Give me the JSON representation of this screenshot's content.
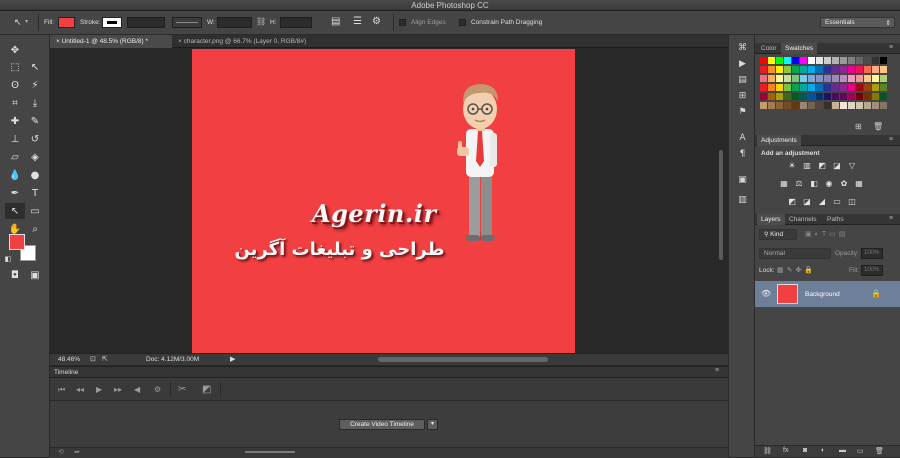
{
  "app": {
    "title": "Adobe Photoshop CC"
  },
  "options_bar": {
    "fill_label": "Fill:",
    "stroke_label": "Stroke:",
    "w_label": "W:",
    "h_label": "H:",
    "align_edges_label": "Align Edges",
    "constrain_label": "Constrain Path Dragging",
    "workspace": "Essentials",
    "fill_color": "#f23f41"
  },
  "tabs": [
    {
      "label": "Untitled-1 @ 48.5% (RGB/8) *",
      "close": "×"
    },
    {
      "label": "character.png @ 66.7% (Layer 0, RGB/8#)",
      "close": "×"
    }
  ],
  "canvas": {
    "bg": "#f23f41",
    "logo_text": "Agerin.ir",
    "persian_text": "طراحی و تبلیغات آگرین"
  },
  "status": {
    "zoom": "48.46%",
    "doc": "Doc: 4.12M/3.00M"
  },
  "timeline": {
    "title": "Timeline",
    "create_button": "Create Video Timeline"
  },
  "color_panel": {
    "tabs": [
      "Color",
      "Swatches"
    ],
    "swatch_rows": [
      [
        "#ff0000",
        "#ffff00",
        "#00ff00",
        "#00ffff",
        "#0000ff",
        "#ff00ff",
        "#ffffff",
        "#e6e6e6",
        "#cccccc",
        "#b3b3b3",
        "#999999",
        "#808080",
        "#666666",
        "#4d4d4d",
        "#333333",
        "#000000"
      ],
      [
        "#ed1c24",
        "#f7941d",
        "#fff200",
        "#8dc63f",
        "#00a651",
        "#00a99d",
        "#00aeef",
        "#0072bc",
        "#2e3192",
        "#662d91",
        "#92278f",
        "#ec008c",
        "#ed145b",
        "#f26c4f",
        "#f9ad81",
        "#fdc689"
      ],
      [
        "#f26d7d",
        "#fbaf5d",
        "#fff799",
        "#c4df9b",
        "#7cc576",
        "#6dcff6",
        "#7da7d9",
        "#8393ca",
        "#8781bd",
        "#a186be",
        "#bc8dbf",
        "#f49ac1",
        "#f5989d",
        "#fdc68a",
        "#fff79a",
        "#acd373"
      ],
      [
        "#ee1d23",
        "#f58220",
        "#ffd400",
        "#7cc242",
        "#00a54f",
        "#00a99e",
        "#00adee",
        "#0072bb",
        "#2e3191",
        "#652d90",
        "#91268f",
        "#eb008b",
        "#9e0b0f",
        "#a0410d",
        "#aba000",
        "#598527"
      ],
      [
        "#9e0039",
        "#a3620a",
        "#aba000",
        "#406618",
        "#005e20",
        "#005952",
        "#0054a6",
        "#003471",
        "#1b1464",
        "#440e62",
        "#630460",
        "#9e005d",
        "#790000",
        "#7b2e00",
        "#827b00",
        "#005826"
      ],
      [
        "#c69c6d",
        "#a67c52",
        "#8c6239",
        "#754c24",
        "#603913",
        "#998675",
        "#736357",
        "#534741",
        "#362f2d",
        "#c7b299",
        "#f2e6d8",
        "#e0d5c4",
        "#d1c4b0",
        "#b8a98f",
        "#a08f78",
        "#857663"
      ]
    ]
  },
  "adjustments": {
    "tab": "Adjustments",
    "heading": "Add an adjustment"
  },
  "layers": {
    "tabs": [
      "Layers",
      "Channels",
      "Paths"
    ],
    "kind": "Kind",
    "blend_mode": "Normal",
    "opacity_label": "Opacity:",
    "opacity": "100%",
    "lock_label": "Lock:",
    "fill_label": "Fill:",
    "fill": "100%",
    "items": [
      {
        "name": "Background",
        "thumb_color": "#f23f41"
      }
    ]
  }
}
